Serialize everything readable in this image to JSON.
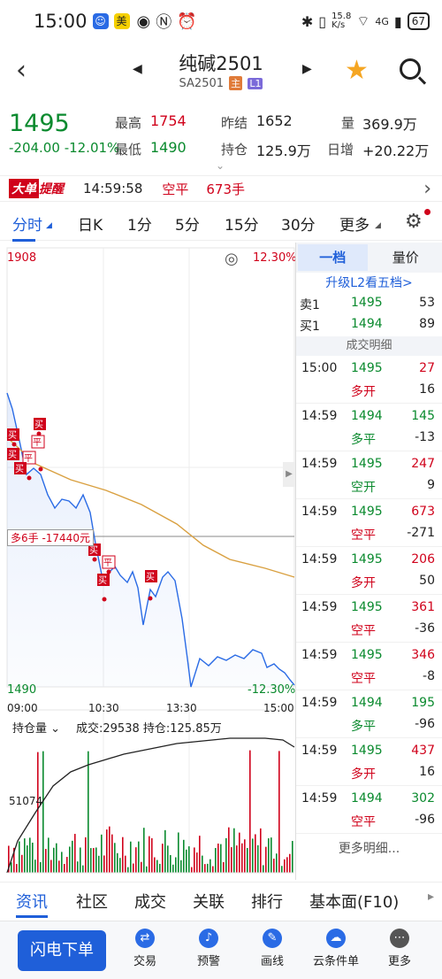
{
  "status": {
    "time": "15:00",
    "net_speed": "15.8\nK/s",
    "network": "4G",
    "battery": "67"
  },
  "header": {
    "title": "纯碱2501",
    "subtitle": "SA2501",
    "tag_main": "主",
    "tag_l1": "L1"
  },
  "quote": {
    "price": "1495",
    "change": "-204.00",
    "change_pct": "-12.01%",
    "high_label": "最高",
    "high": "1754",
    "low_label": "最低",
    "low": "1490",
    "prev_label": "昨结",
    "prev": "1652",
    "oi_label": "持仓",
    "oi": "125.9万",
    "vol_label": "量",
    "vol": "369.9万",
    "daily_label": "日增",
    "daily": "+20.22万"
  },
  "alert": {
    "badge": "大单",
    "badge2": "提醒",
    "time": "14:59:58",
    "type": "空平",
    "qty": "673手"
  },
  "tabs": [
    "分时",
    "日K",
    "1分",
    "5分",
    "15分",
    "30分",
    "更多"
  ],
  "chart": {
    "top_left": "1908",
    "top_right": "12.30%",
    "bottom_left": "1490",
    "bottom_right": "-12.30%",
    "times": [
      "09:00",
      "10:30",
      "13:30",
      "15:00"
    ],
    "tooltip": "多6手 -17440元",
    "vol_selector": "持仓量",
    "vol_info": "成交:29538 持仓:125.85万",
    "vol_mark": "51074"
  },
  "right_panel": {
    "tab_active": "一档",
    "tab_other": "量价",
    "upgrade": "升级L2看五档>",
    "sell1": {
      "label": "卖1",
      "price": "1495",
      "qty": "53"
    },
    "buy1": {
      "label": "买1",
      "price": "1494",
      "qty": "89"
    },
    "detail_header": "成交明细",
    "trades": [
      {
        "time": "15:00",
        "price": "1495",
        "qty": "27",
        "type": "多开",
        "oi": "16"
      },
      {
        "time": "14:59",
        "price": "1494",
        "qty": "145",
        "type": "多平",
        "oi": "-13"
      },
      {
        "time": "14:59",
        "price": "1495",
        "qty": "247",
        "type": "空开",
        "oi": "9"
      },
      {
        "time": "14:59",
        "price": "1495",
        "qty": "673",
        "type": "空平",
        "oi": "-271"
      },
      {
        "time": "14:59",
        "price": "1495",
        "qty": "206",
        "type": "多开",
        "oi": "50"
      },
      {
        "time": "14:59",
        "price": "1495",
        "qty": "361",
        "type": "空平",
        "oi": "-36"
      },
      {
        "time": "14:59",
        "price": "1495",
        "qty": "346",
        "type": "空平",
        "oi": "-8"
      },
      {
        "time": "14:59",
        "price": "1494",
        "qty": "195",
        "type": "多平",
        "oi": "-96"
      },
      {
        "time": "14:59",
        "price": "1495",
        "qty": "437",
        "type": "多开",
        "oi": "16"
      },
      {
        "time": "14:59",
        "price": "1494",
        "qty": "302",
        "type": "空平",
        "oi": "-96"
      }
    ],
    "more": "更多明细..."
  },
  "bottom_tabs": [
    "资讯",
    "社区",
    "成交",
    "关联",
    "排行",
    "基本面(F10)"
  ],
  "actions": {
    "flash": "闪电下单",
    "trade": "交易",
    "alert": "预警",
    "draw": "画线",
    "cloud": "云条件单",
    "more": "更多"
  },
  "colors": {
    "up": "#d0021b",
    "down": "#0a8a2e",
    "accent": "#1f5fd9",
    "avg_line": "#d9a040",
    "price_line": "#2a6be5"
  }
}
